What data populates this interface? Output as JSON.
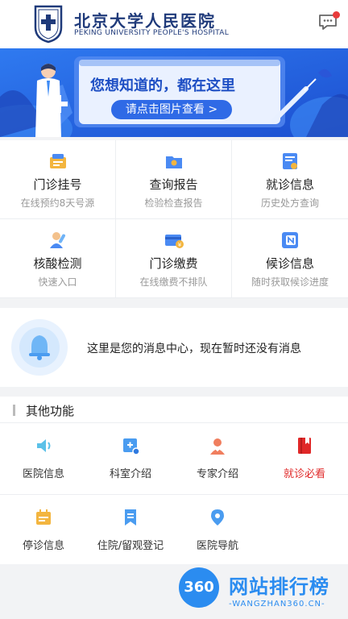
{
  "header": {
    "brand_cn": "北京大学人民医院",
    "brand_en": "PEKING UNIVERSITY PEOPLE'S HOSPITAL",
    "logo_icon": "hospital-emblem-icon",
    "message_icon": "chat-bubble-icon"
  },
  "banner": {
    "title": "您想知道的，都在这里",
    "button": "请点击图片查看 >"
  },
  "services": [
    {
      "title": "门诊挂号",
      "sub": "在线预约8天号源",
      "icon": "registration-icon"
    },
    {
      "title": "查询报告",
      "sub": "检验检查报告",
      "icon": "report-icon"
    },
    {
      "title": "就诊信息",
      "sub": "历史处方查询",
      "icon": "visit-info-icon"
    },
    {
      "title": "核酸检测",
      "sub": "快速入口",
      "icon": "nucleic-test-icon"
    },
    {
      "title": "门诊缴费",
      "sub": "在线缴费不排队",
      "icon": "payment-icon"
    },
    {
      "title": "候诊信息",
      "sub": "随时获取候诊进度",
      "icon": "waiting-info-icon"
    }
  ],
  "message_center": {
    "text": "这里是您的消息中心，现在暂时还没有消息",
    "icon": "bell-icon"
  },
  "other": {
    "title": "其他功能",
    "items": [
      {
        "label": "医院信息",
        "icon": "speaker-icon"
      },
      {
        "label": "科室介绍",
        "icon": "department-icon"
      },
      {
        "label": "专家介绍",
        "icon": "doctor-icon"
      },
      {
        "label": "就诊必看",
        "icon": "book-icon"
      },
      {
        "label": "停诊信息",
        "icon": "calendar-icon"
      },
      {
        "label": "住院/留观登记",
        "icon": "bookmark-icon"
      },
      {
        "label": "医院导航",
        "icon": "location-pin-icon"
      }
    ]
  },
  "watermark": {
    "badge": "360",
    "cn": "网站排行榜",
    "en": "-WANGZHAN360.CN-"
  },
  "colors": {
    "brand_blue": "#1f3a7a",
    "accent_blue": "#2f6ae6",
    "red": "#e02828",
    "page_bg": "#f2f3f5"
  }
}
